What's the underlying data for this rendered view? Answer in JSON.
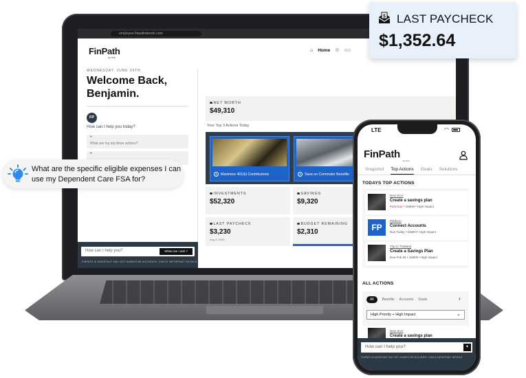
{
  "laptop": {
    "url": "employee.finpathatwork.com",
    "logo": "FinPath",
    "logo_sub": "by Hub",
    "nav": {
      "home": "Home",
      "act": "Act"
    },
    "date": "WEDNESDAY, JUNE 25TH",
    "welcome": "Welcome Back, Benjamin.",
    "avatar": "FP",
    "help_prompt": "How can I help you today?",
    "chips": [
      {
        "quote": "“",
        "text": "What are my top three actions?"
      },
      {
        "quote": "“",
        "text": ""
      }
    ],
    "input_placeholder": "How can I help you?",
    "ask_button": "What can I ask ?",
    "disclaimer": "FINPATH AI ASSISTANT MAY NOT ALWAYS BE ACCURATE. CHECK IMPORTANT DETAILS",
    "net_worth": {
      "label": "NET WORTH",
      "value": "$49,310"
    },
    "top_actions_label": "Your Top 3 Actions Today",
    "actions": [
      {
        "num": "1",
        "title": "Maximize 401(k) Contributions"
      },
      {
        "num": "2",
        "title": "Save on Commuter Benefits"
      },
      {
        "num": "3",
        "title": ""
      }
    ],
    "investments": {
      "label": "INVESTMENTS",
      "value": "$52,320"
    },
    "savings": {
      "label": "SAVINGS",
      "value": "$9,320"
    },
    "last_paycheck": {
      "label": "LAST PAYCHECK",
      "value": "$3,230",
      "date": "Aug 3, 2026"
    },
    "budget": {
      "label": "BUDGET REMAINING",
      "value": "$2,310"
    }
  },
  "callout": {
    "title": "LAST PAYCHECK",
    "amount": "$1,352.64",
    "icon": "money-envelope-icon"
  },
  "question": {
    "text": "What are the specific eligible expenses I can use my Dependent Care FSA for?",
    "icon": "lightbulb-icon"
  },
  "phone": {
    "carrier": "LTE",
    "logo": "FinPath",
    "logo_sub": "by Hub",
    "tabs": [
      "Snapshot",
      "Top Actions",
      "Goals",
      "Solutions"
    ],
    "active_tab": "Top Actions",
    "top_actions_title": "TODAYS TOP ACTIONS",
    "items": [
      {
        "category": "New SUV",
        "name": "Create a savings plan",
        "due": "Past Due",
        "meta": " •  15MIN  •  High Impact"
      },
      {
        "category": "Platform",
        "name": "Connect Accounts",
        "due": "Due Today",
        "meta": " •  15MIN  •  High Impact"
      },
      {
        "category": "Trip to Thailand",
        "name": "Create a Savings Plan",
        "due": "Due Feb 25",
        "meta": " •  15MIN  •  High Impact"
      }
    ],
    "all_actions_title": "ALL ACTIONS",
    "filters": [
      "All",
      "Benefits",
      "Accounts",
      "Goals"
    ],
    "select_value": "High Priority + High Impact",
    "item4": {
      "category": "New SUV",
      "name": "Create a savings plan"
    },
    "input_placeholder": "How can I help you?",
    "disclaimer": "FINPATH AI ASSISTANT MAY NOT ALWAYS BE ACCURATE. CHECK IMPORTANT DETAILS"
  },
  "colors": {
    "accent_blue": "#1e63c7",
    "dark_navy": "#2c3945",
    "callout_bg": "#e8f0fb",
    "past_due_red": "#d03030"
  }
}
